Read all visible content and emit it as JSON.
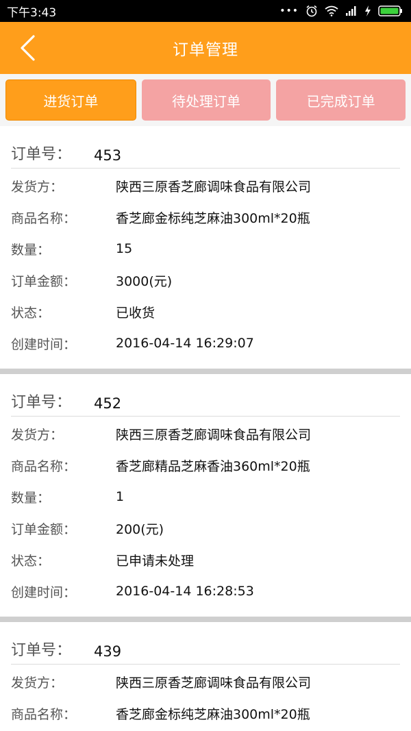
{
  "status": {
    "time": "下午3:43",
    "dots": "•••"
  },
  "header": {
    "title": "订单管理"
  },
  "tabs": [
    {
      "label": "进货订单",
      "active": true
    },
    {
      "label": "待处理订单",
      "active": false
    },
    {
      "label": "已完成订单",
      "active": false
    }
  ],
  "labels": {
    "order_no": "订单号：",
    "shipper": "发货方：",
    "product": "商品名称：",
    "quantity": "数量：",
    "amount": "订单金额：",
    "state": "状态：",
    "created": "创建时间："
  },
  "orders": [
    {
      "order_no": "453",
      "shipper": "陕西三原香芝廊调味食品有限公司",
      "product": "香芝廊金标纯芝麻油300ml*20瓶",
      "quantity": "15",
      "amount": "3000(元)",
      "state": "已收货",
      "created": "2016-04-14 16:29:07"
    },
    {
      "order_no": "452",
      "shipper": "陕西三原香芝廊调味食品有限公司",
      "product": "香芝廊精品芝麻香油360ml*20瓶",
      "quantity": "1",
      "amount": "200(元)",
      "state": "已申请未处理",
      "created": "2016-04-14 16:28:53"
    },
    {
      "order_no": "439",
      "shipper": "陕西三原香芝廊调味食品有限公司",
      "product": "香芝廊金标纯芝麻油300ml*20瓶"
    }
  ]
}
